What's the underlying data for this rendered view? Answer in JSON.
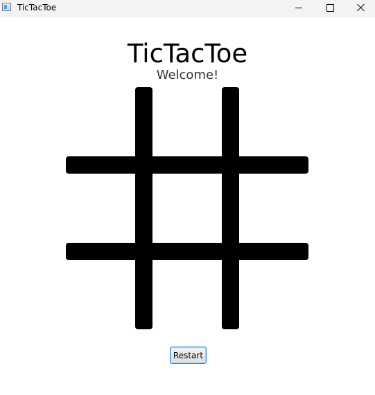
{
  "window": {
    "title": "TicTacToe",
    "icon": "java-app-icon",
    "controls": [
      "minimize-icon",
      "maximize-icon",
      "close-icon"
    ]
  },
  "main": {
    "title": "TicTacToe",
    "status": "Welcome!"
  },
  "board": {
    "rows": 3,
    "cols": 3,
    "cells": [
      "",
      "",
      "",
      "",
      "",
      "",
      "",
      "",
      ""
    ],
    "grid_color": "#000000"
  },
  "actions": {
    "restart_label": "Restart"
  }
}
